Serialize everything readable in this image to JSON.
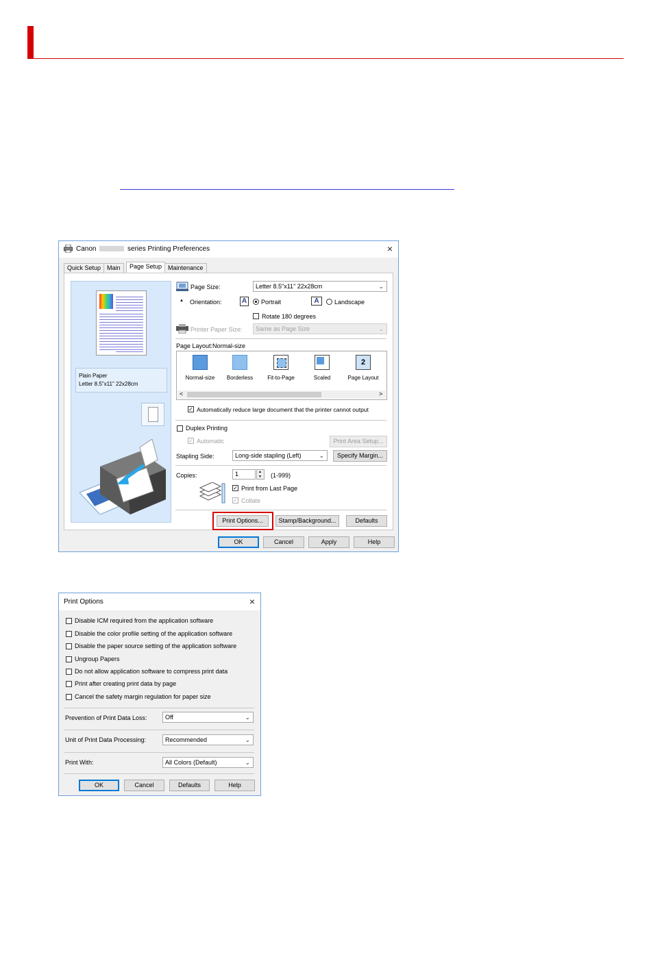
{
  "printing_prefs": {
    "title_prefix": "Canon",
    "title_suffix": "series Printing Preferences",
    "close_glyph": "×",
    "tabs": [
      "Quick Setup",
      "Main",
      "Page Setup",
      "Maintenance"
    ],
    "active_tab": "Page Setup",
    "preview": {
      "media_line1": "Plain Paper",
      "media_line2": "Letter 8.5\"x11\" 22x28cm"
    },
    "page_size": {
      "label": "Page Size:",
      "value": "Letter 8.5\"x11\" 22x28cm"
    },
    "orientation": {
      "label": "Orientation:",
      "icon_glyph": "A",
      "portrait": "Portrait",
      "landscape": "Landscape",
      "selected": "Portrait"
    },
    "rotate_180": {
      "label": "Rotate 180 degrees",
      "checked": false
    },
    "printer_paper_size": {
      "label": "Printer Paper Size:",
      "value": "Same as Page Size"
    },
    "page_layout": {
      "label": "Page Layout:Normal-size",
      "items": [
        "Normal-size",
        "Borderless",
        "Fit-to-Page",
        "Scaled",
        "Page Layout"
      ],
      "page_layout_icon_glyph": "2",
      "scroll_left": "<",
      "scroll_right": ">"
    },
    "auto_reduce": {
      "label": "Automatically reduce large document that the printer cannot output",
      "checked": true
    },
    "duplex": {
      "label": "Duplex Printing",
      "checked": false
    },
    "automatic": {
      "label": "Automatic",
      "checked": true
    },
    "print_area_setup": "Print Area Setup...",
    "stapling": {
      "label": "Stapling Side:",
      "value": "Long-side stapling (Left)"
    },
    "specify_margin": "Specify Margin...",
    "copies": {
      "label": "Copies:",
      "value": "1",
      "range": "(1-999)"
    },
    "print_from_last": {
      "label": "Print from Last Page",
      "checked": true
    },
    "collate": {
      "label": "Collate",
      "checked": true
    },
    "check_glyph": "✓",
    "spin_up": "▲",
    "spin_down": "▼",
    "print_options_btn": "Print Options...",
    "stamp_btn": "Stamp/Background...",
    "defaults_btn": "Defaults",
    "ok_btn": "OK",
    "cancel_btn": "Cancel",
    "apply_btn": "Apply",
    "help_btn": "Help",
    "chevron_glyph": "⌄",
    "highlight_color": "#d40000"
  },
  "print_options": {
    "title": "Print Options",
    "close_glyph": "×",
    "checkboxes": [
      "Disable ICM required from the application software",
      "Disable the color profile setting of the application software",
      "Disable the paper source setting of the application software",
      "Ungroup Papers",
      "Do not allow application software to compress print data",
      "Print after creating print data by page",
      "Cancel the safety margin regulation for paper size"
    ],
    "prevention": {
      "label": "Prevention of Print Data Loss:",
      "value": "Off"
    },
    "unit": {
      "label": "Unit of Print Data Processing:",
      "value": "Recommended"
    },
    "print_with": {
      "label": "Print With:",
      "value": "All Colors (Default)"
    },
    "ok_btn": "OK",
    "cancel_btn": "Cancel",
    "defaults_btn": "Defaults",
    "help_btn": "Help"
  }
}
